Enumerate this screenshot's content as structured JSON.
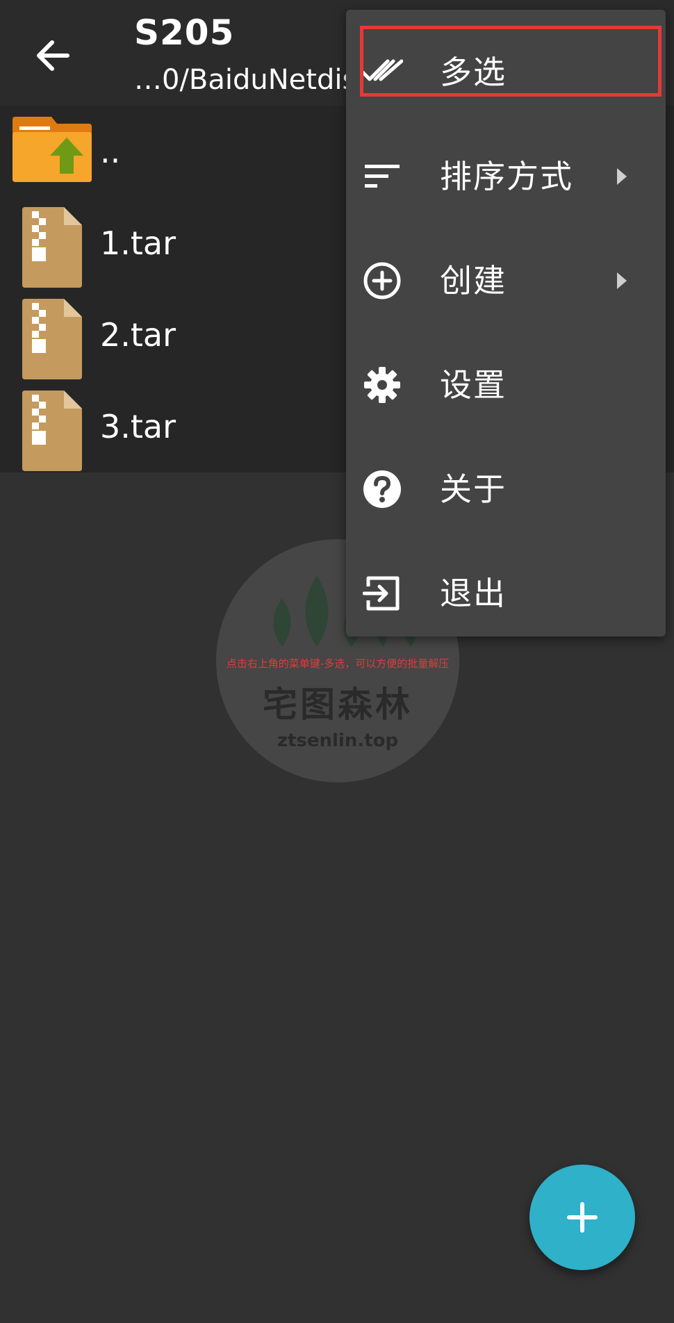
{
  "toolbar": {
    "title": "S205",
    "path": "…0/BaiduNetdisk",
    "back_icon": "arrow-back-icon"
  },
  "files": [
    {
      "name": "..",
      "icon": "folder-up-icon"
    },
    {
      "name": "1.tar",
      "icon": "archive-file-icon"
    },
    {
      "name": "2.tar",
      "icon": "archive-file-icon"
    },
    {
      "name": "3.tar",
      "icon": "archive-file-icon"
    }
  ],
  "menu": {
    "items": [
      {
        "label": "多选",
        "icon": "double-check-icon",
        "submenu": false
      },
      {
        "label": "排序方式",
        "icon": "sort-icon",
        "submenu": true
      },
      {
        "label": "创建",
        "icon": "add-circle-icon",
        "submenu": true
      },
      {
        "label": "设置",
        "icon": "gear-icon",
        "submenu": false
      },
      {
        "label": "关于",
        "icon": "help-circle-icon",
        "submenu": false
      },
      {
        "label": "退出",
        "icon": "exit-icon",
        "submenu": false
      }
    ],
    "highlighted_item": "多选"
  },
  "watermark": {
    "caption": "点击右上角的菜单键-多选，可以方便的批量解压",
    "title": "宅图森林",
    "url": "ztsenlin.top"
  },
  "fab": {
    "icon": "plus-icon"
  },
  "colors": {
    "background": "#313131",
    "toolbar": "#2b2b2b",
    "file_list": "#262626",
    "menu": "#444444",
    "accent": "#2eb1c9",
    "highlight": "#e53935"
  }
}
